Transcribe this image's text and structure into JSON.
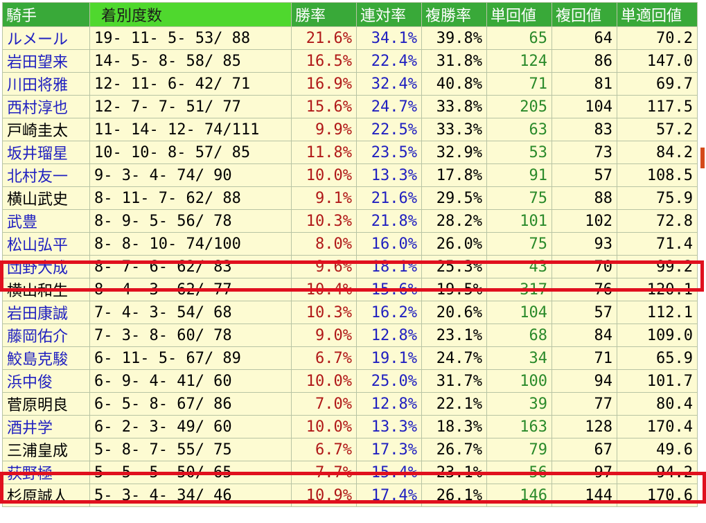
{
  "headers": {
    "name": "騎手",
    "record": "着別度数",
    "win_rate": "勝率",
    "place_rate": "連対率",
    "show_rate": "複勝率",
    "win_return": "単回値",
    "show_return": "複回値",
    "adj_return": "単適回値"
  },
  "colors": {
    "header_green": "#39a939",
    "record_header_green": "#4fd82e",
    "row_background": "#fdfbd2",
    "highlight_red": "#e0101e",
    "name_blue": "#2020c0",
    "win_rate_red": "#b01818",
    "return_green": "#2a8a2a"
  },
  "rows": [
    {
      "name": "ルメール",
      "link": true,
      "record": "19- 11-  5- 53/ 88",
      "win": "21.6%",
      "place": "34.1%",
      "show": "39.8%",
      "tansho": "65",
      "fukusho": "64",
      "tekisei": "70.2"
    },
    {
      "name": "岩田望来",
      "link": true,
      "record": "14-  5-  8- 58/ 85",
      "win": "16.5%",
      "place": "22.4%",
      "show": "31.8%",
      "tansho": "124",
      "fukusho": "86",
      "tekisei": "147.0"
    },
    {
      "name": "川田将雅",
      "link": true,
      "record": "12- 11-  6- 42/ 71",
      "win": "16.9%",
      "place": "32.4%",
      "show": "40.8%",
      "tansho": "71",
      "fukusho": "81",
      "tekisei": "69.7"
    },
    {
      "name": "西村淳也",
      "link": true,
      "record": "12-  7-  7- 51/ 77",
      "win": "15.6%",
      "place": "24.7%",
      "show": "33.8%",
      "tansho": "205",
      "fukusho": "104",
      "tekisei": "117.5"
    },
    {
      "name": "戸崎圭太",
      "link": false,
      "record": "11- 14- 12- 74/111",
      "win": "9.9%",
      "place": "22.5%",
      "show": "33.3%",
      "tansho": "63",
      "fukusho": "83",
      "tekisei": "57.2"
    },
    {
      "name": "坂井瑠星",
      "link": true,
      "record": "10- 10-  8- 57/ 85",
      "win": "11.8%",
      "place": "23.5%",
      "show": "32.9%",
      "tansho": "53",
      "fukusho": "73",
      "tekisei": "84.2"
    },
    {
      "name": "北村友一",
      "link": true,
      "record": " 9-  3-  4- 74/ 90",
      "win": "10.0%",
      "place": "13.3%",
      "show": "17.8%",
      "tansho": "91",
      "fukusho": "57",
      "tekisei": "108.5"
    },
    {
      "name": "横山武史",
      "link": false,
      "record": " 8- 11-  7- 62/ 88",
      "win": "9.1%",
      "place": "21.6%",
      "show": "29.5%",
      "tansho": "75",
      "fukusho": "88",
      "tekisei": "75.9"
    },
    {
      "name": "武豊",
      "link": true,
      "record": " 8-  9-  5- 56/ 78",
      "win": "10.3%",
      "place": "21.8%",
      "show": "28.2%",
      "tansho": "101",
      "fukusho": "102",
      "tekisei": "72.8"
    },
    {
      "name": "松山弘平",
      "link": true,
      "record": " 8-  8- 10- 74/100",
      "win": "8.0%",
      "place": "16.0%",
      "show": "26.0%",
      "tansho": "75",
      "fukusho": "93",
      "tekisei": "71.4"
    },
    {
      "name": "団野大成",
      "link": true,
      "record": " 8-  7-  6- 62/ 83",
      "win": "9.6%",
      "place": "18.1%",
      "show": "25.3%",
      "tansho": "43",
      "fukusho": "70",
      "tekisei": "99.2"
    },
    {
      "name": "横山和生",
      "link": false,
      "record": " 8-  4-  3- 62/ 77",
      "win": "10.4%",
      "place": "15.6%",
      "show": "19.5%",
      "tansho": "317",
      "fukusho": "76",
      "tekisei": "120.1"
    },
    {
      "name": "岩田康誠",
      "link": true,
      "record": " 7-  4-  3- 54/ 68",
      "win": "10.3%",
      "place": "16.2%",
      "show": "20.6%",
      "tansho": "104",
      "fukusho": "57",
      "tekisei": "112.1"
    },
    {
      "name": "藤岡佑介",
      "link": true,
      "record": " 7-  3-  8- 60/ 78",
      "win": "9.0%",
      "place": "12.8%",
      "show": "23.1%",
      "tansho": "68",
      "fukusho": "84",
      "tekisei": "109.0"
    },
    {
      "name": "鮫島克駿",
      "link": true,
      "record": " 6- 11-  5- 67/ 89",
      "win": "6.7%",
      "place": "19.1%",
      "show": "24.7%",
      "tansho": "34",
      "fukusho": "71",
      "tekisei": "65.9"
    },
    {
      "name": "浜中俊",
      "link": true,
      "record": " 6-  9-  4- 41/ 60",
      "win": "10.0%",
      "place": "25.0%",
      "show": "31.7%",
      "tansho": "100",
      "fukusho": "94",
      "tekisei": "101.7"
    },
    {
      "name": "菅原明良",
      "link": false,
      "record": " 6-  5-  8- 67/ 86",
      "win": "7.0%",
      "place": "12.8%",
      "show": "22.1%",
      "tansho": "39",
      "fukusho": "77",
      "tekisei": "80.4"
    },
    {
      "name": "酒井学",
      "link": true,
      "record": " 6-  2-  3- 49/ 60",
      "win": "10.0%",
      "place": "13.3%",
      "show": "18.3%",
      "tansho": "163",
      "fukusho": "128",
      "tekisei": "170.4"
    },
    {
      "name": "三浦皇成",
      "link": false,
      "record": " 5-  8-  7- 55/ 75",
      "win": "6.7%",
      "place": "17.3%",
      "show": "26.7%",
      "tansho": "79",
      "fukusho": "67",
      "tekisei": "49.6"
    },
    {
      "name": "荻野極",
      "link": true,
      "record": " 5-  5-  5- 50/ 65",
      "win": "7.7%",
      "place": "15.4%",
      "show": "23.1%",
      "tansho": "56",
      "fukusho": "97",
      "tekisei": "94.2"
    },
    {
      "name": "杉原誠人",
      "link": false,
      "record": " 5-  3-  4- 34/ 46",
      "win": "10.9%",
      "place": "17.4%",
      "show": "26.1%",
      "tansho": "146",
      "fukusho": "144",
      "tekisei": "170.6"
    }
  ]
}
